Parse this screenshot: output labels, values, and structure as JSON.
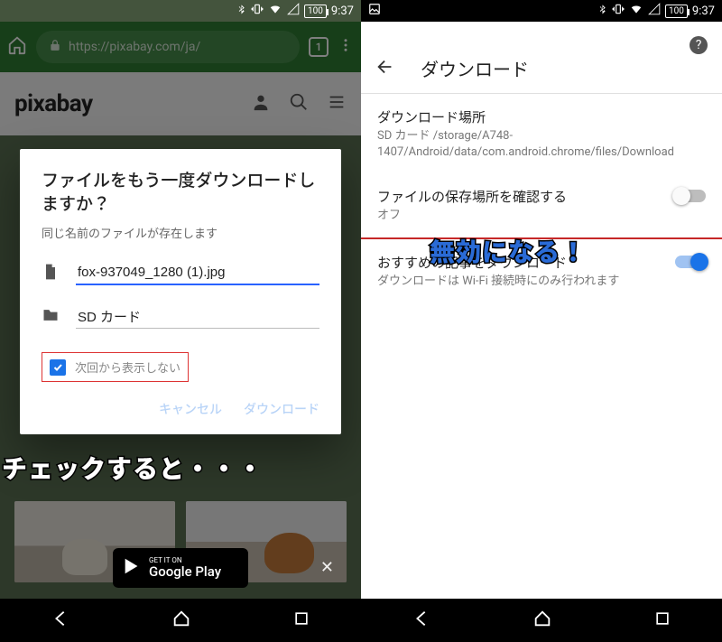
{
  "status": {
    "battery": "100",
    "time": "9:37"
  },
  "left": {
    "url": "https://pixabay.com/ja/",
    "tab_count": "1",
    "site_logo": "pixabay",
    "dialog": {
      "title": "ファイルをもう一度ダウンロードしますか？",
      "subtitle": "同じ名前のファイルが存在します",
      "filename": "fox-937049_1280 (1).jpg",
      "location": "SD カード",
      "checkbox_label": "次回から表示しない",
      "btn_cancel": "キャンセル",
      "btn_ok": "ダウンロード"
    },
    "gplay": {
      "line1": "GET IT ON",
      "line2": "Google Play"
    },
    "annotation": "チェックすると・・・"
  },
  "right": {
    "header": "ダウンロード",
    "items": [
      {
        "title": "ダウンロード場所",
        "sub": "SD カード /storage/A748-1407/Android/data/com.android.chrome/files/Download"
      },
      {
        "title": "ファイルの保存場所を確認する",
        "sub": "オフ"
      },
      {
        "title": "おすすめの記事をダウンロード",
        "sub": "ダウンロードは Wi-Fi 接続時にのみ行われます"
      }
    ],
    "annotation": "無効になる！"
  }
}
